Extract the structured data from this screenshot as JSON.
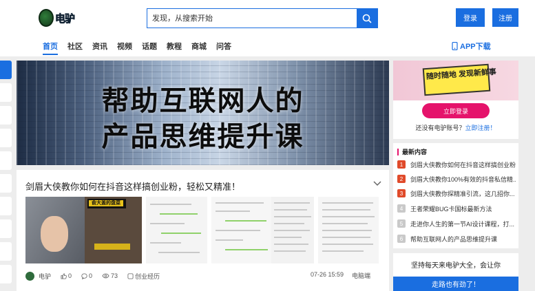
{
  "header": {
    "logo_text": "电驴",
    "search_placeholder": "发现，从搜索开始",
    "login_label": "登录",
    "register_label": "注册",
    "nav": [
      "首页",
      "社区",
      "资讯",
      "视频",
      "话题",
      "教程",
      "商城",
      "问答"
    ],
    "active_nav": "首页",
    "app_download": "APP下载"
  },
  "banner": {
    "line1": "帮助互联网人的",
    "line2": "产品思维提升课"
  },
  "post": {
    "title": "剑眉大侠教你如何在抖音这样搞创业粉，轻松又精准！",
    "thumb1_tag": "俞大盖的盘菜",
    "author": "电驴",
    "likes": "0",
    "comments": "0",
    "views": "73",
    "category": "创业经历",
    "time": "07-26 15:59",
    "source": "电脑端"
  },
  "promo": {
    "slogan": "随时随地 发现新鲜事",
    "login_button": "立即登录",
    "no_account": "还没有电驴账号？",
    "register_link": "立即注册！"
  },
  "latest": {
    "heading": "最新内容",
    "items": [
      {
        "num": "1",
        "text": "剑眉大侠教你如何在抖音这样搞创业粉..."
      },
      {
        "num": "2",
        "text": "剑眉大侠教你100%有效的抖音私信精..."
      },
      {
        "num": "3",
        "text": "剑眉大侠教你探精准引流，这几招你..."
      },
      {
        "num": "4",
        "text": "王者荣耀BUG卡国标最新方法"
      },
      {
        "num": "5",
        "text": "走进你人生的第一节AI设计课程，打..."
      },
      {
        "num": "6",
        "text": "帮助互联网人的产品思维提升课"
      }
    ]
  },
  "motto": {
    "text": "坚持每天来电驴大全，会让你",
    "button": "走路也有劲了！"
  }
}
